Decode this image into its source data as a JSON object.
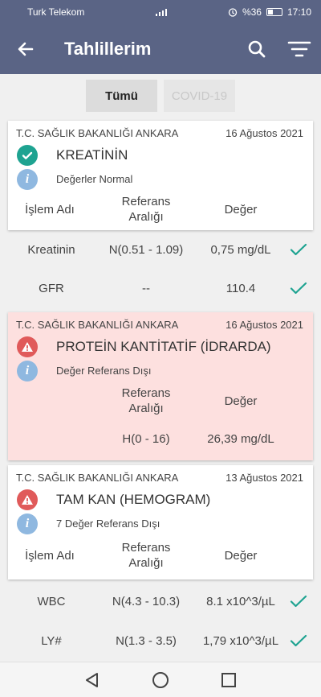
{
  "status_bar": {
    "carrier": "Turk Telekom",
    "battery": "%36",
    "time": "17:10"
  },
  "app_bar": {
    "title": "Tahlillerim"
  },
  "tabs": [
    {
      "label": "Tümü"
    },
    {
      "label": "COVID-19"
    }
  ],
  "columns": {
    "name": "İşlem Adı",
    "ref": "Referans Aralığı",
    "value": "Değer"
  },
  "cards": [
    {
      "institution": "T.C. SAĞLIK BAKANLIĞI ANKARA",
      "date": "16 Ağustos 2021",
      "test_name": "KREATİNİN",
      "status_text": "Değerler Normal",
      "rows": [
        {
          "name": "Kreatinin",
          "ref": "N(0.51 - 1.09)",
          "value": "0,75 mg/dL"
        },
        {
          "name": "GFR",
          "ref": "--",
          "value": "110.4"
        }
      ]
    },
    {
      "institution": "T.C. SAĞLIK BAKANLIĞI ANKARA",
      "date": "16 Ağustos 2021",
      "test_name": "PROTEİN KANTİTATİF (İDRARDA)",
      "status_text": "Değer Referans Dışı",
      "rows": [
        {
          "name": "",
          "ref": "H(0 - 16)",
          "value": "26,39 mg/dL"
        }
      ]
    },
    {
      "institution": "T.C. SAĞLIK BAKANLIĞI ANKARA",
      "date": "13 Ağustos 2021",
      "test_name": "TAM KAN (HEMOGRAM)",
      "status_text": "7 Değer Referans Dışı",
      "rows": [
        {
          "name": "WBC",
          "ref": "N(4.3 - 10.3)",
          "value": "8.1 x10^3/µL"
        },
        {
          "name": "LY#",
          "ref": "N(1.3 - 3.5)",
          "value": "1,79 x10^3/µL"
        }
      ]
    }
  ],
  "colors": {
    "app_bar": "#5a6485",
    "ok": "#1ea391",
    "alert": "#e05a5a",
    "alert_card_bg": "#fde0df"
  },
  "icons": [
    "back-arrow-icon",
    "search-icon",
    "filter-icon",
    "check-circle-icon",
    "warning-icon",
    "info-icon",
    "check-icon",
    "nav-back-icon",
    "nav-home-icon",
    "nav-recents-icon"
  ]
}
